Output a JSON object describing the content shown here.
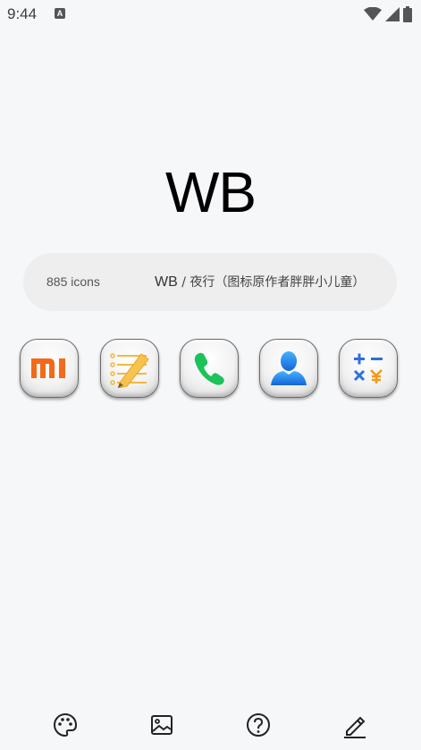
{
  "status_bar": {
    "time": "9:44",
    "notification_letter": "A",
    "icons": [
      "wifi-icon",
      "cellular-signal-icon",
      "battery-icon"
    ]
  },
  "header": {
    "title": "WB"
  },
  "info": {
    "icon_count": "885 icons",
    "pack_name": "WB",
    "pack_separator": " / ",
    "pack_description": "夜行（图标原作者胖胖小儿童）"
  },
  "preview_icons": [
    {
      "name": "mi-logo-icon"
    },
    {
      "name": "notes-pencil-icon"
    },
    {
      "name": "phone-icon"
    },
    {
      "name": "contacts-icon"
    },
    {
      "name": "calculator-icon"
    }
  ],
  "colors": {
    "background": "#f6f7f9",
    "pill": "#eeeeef",
    "mi_orange": "#f26a1b",
    "notes_yellow": "#f6b73c",
    "phone_green": "#1dc25a",
    "contacts_blue": "#1e88e5",
    "calc_blue": "#2f6fe0",
    "calc_orange": "#f29a1b"
  },
  "bottom_nav": {
    "items": [
      "palette-icon",
      "wallpaper-icon",
      "help-icon",
      "edit-icon"
    ]
  }
}
